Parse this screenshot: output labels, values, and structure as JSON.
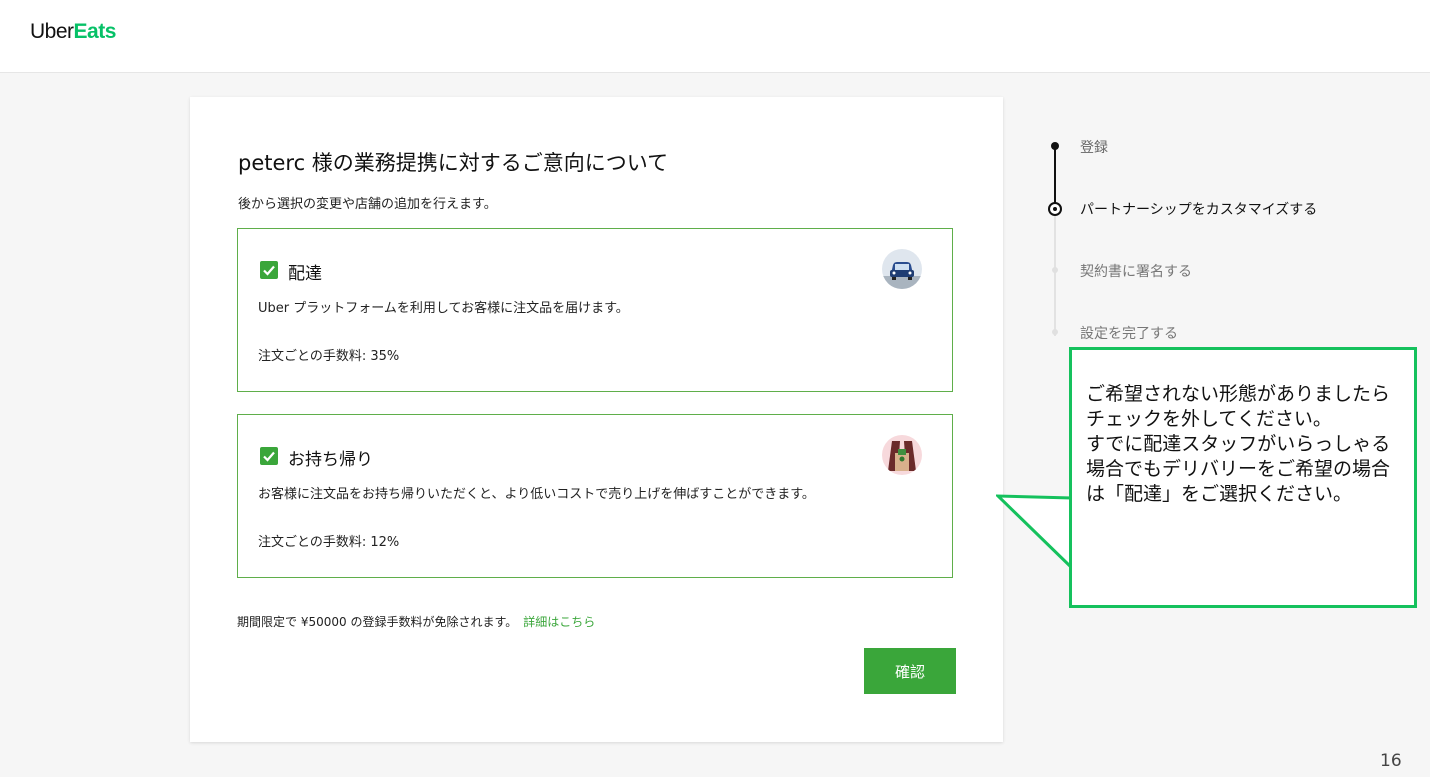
{
  "brand": {
    "uber": "Uber",
    "eats": "Eats"
  },
  "card": {
    "title": "peterc 様の業務提携に対するご意向について",
    "subtitle": "後から選択の変更や店舗の追加を行えます。",
    "options": [
      {
        "title": "配達",
        "description": "Uber プラットフォームを利用してお客様に注文品を届けます。",
        "fee": "注文ごとの手数料: 35%",
        "checked": true,
        "icon": "car-icon"
      },
      {
        "title": "お持ち帰り",
        "description": "お客様に注文品をお持ち帰りいただくと、より低いコストで売り上げを伸ばすことができます。",
        "fee": "注文ごとの手数料: 12%",
        "checked": true,
        "icon": "takeout-bag-icon"
      }
    ],
    "promo": "期間限定で ¥50000 の登録手数料が免除されます。",
    "promo_link": "詳細はこちら",
    "confirm_label": "確認"
  },
  "steps": [
    {
      "label": "登録",
      "state": "done"
    },
    {
      "label": "パートナーシップをカスタマイズする",
      "state": "current"
    },
    {
      "label": "契約書に署名する",
      "state": "pending"
    },
    {
      "label": "設定を完了する",
      "state": "pending"
    }
  ],
  "callout": {
    "text": "ご希望されない形態がありましたらチェックを外してください。\nすでに配達スタッフがいらっしゃる場合でもデリバリーをご希望の場合は「配達」をご選択ください。"
  },
  "page_number": "16",
  "colors": {
    "brand_green": "#06c167",
    "accent_green": "#3aa63a",
    "callout_border": "#15c15d"
  }
}
